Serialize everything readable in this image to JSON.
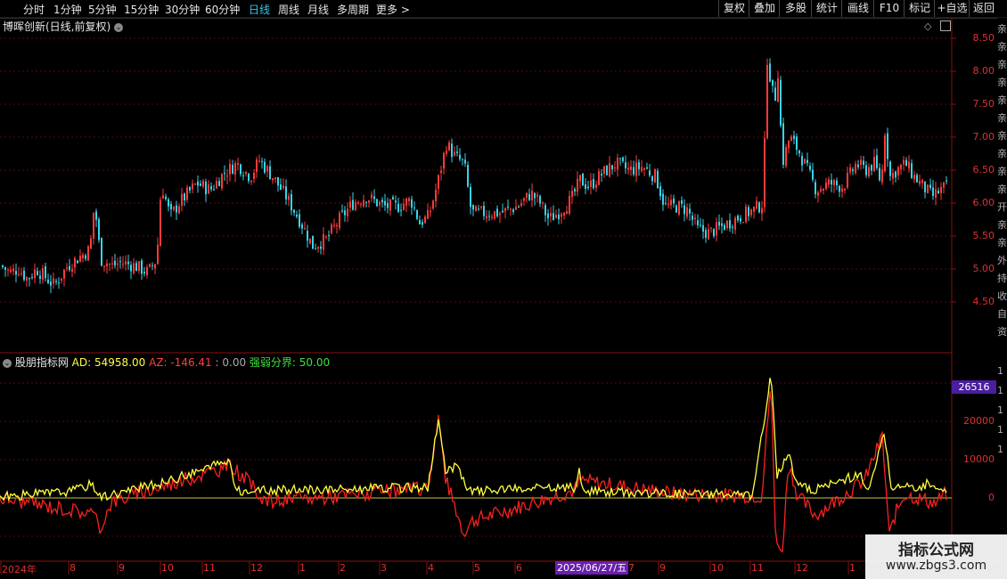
{
  "toolbar": {
    "periods": [
      "分时",
      "1分钟",
      "5分钟",
      "15分钟",
      "30分钟",
      "60分钟",
      "日线",
      "周线",
      "月线",
      "多周期",
      "更多 >"
    ],
    "active_period": "日线",
    "right_buttons": [
      "复权",
      "叠加",
      "多股",
      "统计",
      "画线",
      "F10",
      "标记",
      "+自选",
      "返回"
    ]
  },
  "main_chart": {
    "title": "博晖创新(日线,前复权)",
    "y_ticks": [
      "8.50",
      "8.00",
      "7.50",
      "7.00",
      "6.50",
      "6.00",
      "5.50",
      "5.00",
      "4.50"
    ],
    "colors": {
      "up": "#ff3b3b",
      "down": "#38d3e8"
    }
  },
  "indicator": {
    "name": "股朋指标网",
    "ad_label": "AD: 54958.00",
    "az_label": "AZ: -146.41",
    "zero_label": ": 0.00",
    "boundary_label": "强弱分界: 50.00",
    "y_ticks": [
      "20000",
      "10000",
      "0"
    ],
    "current_value": "26516",
    "colors": {
      "ad": "#ffff40",
      "az": "#ff2020",
      "zero": "#c8c840"
    }
  },
  "x_axis": {
    "labels": [
      "2024年",
      "8",
      "9",
      "10",
      "11",
      "12",
      "1",
      "2",
      "3",
      "4",
      "5",
      "6",
      "7",
      "9",
      "10",
      "11",
      "12",
      "1"
    ],
    "cursor_date": "2025/06/27/五"
  },
  "watermark": {
    "line1": "指标公式网",
    "line2": "www.zbgs3.com"
  },
  "right_strip_chars": [
    "亲",
    "亲",
    "亲",
    "亲",
    "亲",
    "亲",
    "亲",
    "亲",
    "亲",
    "亲",
    "开",
    "亲",
    "亲",
    "外",
    "持",
    "收",
    "自",
    "资",
    "1",
    "1",
    "1",
    "1",
    "1"
  ],
  "chart_data": {
    "type": "candlestick",
    "title": "博晖创新(日线,前复权)",
    "ylim": [
      4.35,
      8.75
    ],
    "indicator_ylim": [
      -16000,
      33000
    ],
    "anchors": [
      [
        0,
        5.05
      ],
      [
        10,
        4.95
      ],
      [
        20,
        5.0
      ],
      [
        30,
        4.85
      ],
      [
        40,
        5.0
      ],
      [
        60,
        4.75
      ],
      [
        75,
        5.05
      ],
      [
        90,
        5.2
      ],
      [
        100,
        5.3
      ],
      [
        105,
        6.0
      ],
      [
        112,
        5.15
      ],
      [
        125,
        5.05
      ],
      [
        135,
        5.1
      ],
      [
        150,
        5.05
      ],
      [
        165,
        4.95
      ],
      [
        175,
        5.15
      ],
      [
        180,
        6.3
      ],
      [
        190,
        5.8
      ],
      [
        200,
        6.0
      ],
      [
        220,
        6.3
      ],
      [
        235,
        6.2
      ],
      [
        250,
        6.45
      ],
      [
        265,
        6.6
      ],
      [
        280,
        6.4
      ],
      [
        290,
        6.65
      ],
      [
        305,
        6.4
      ],
      [
        320,
        6.1
      ],
      [
        335,
        5.75
      ],
      [
        350,
        5.35
      ],
      [
        365,
        5.45
      ],
      [
        380,
        5.75
      ],
      [
        395,
        6.0
      ],
      [
        410,
        6.1
      ],
      [
        430,
        5.95
      ],
      [
        445,
        5.95
      ],
      [
        460,
        6.05
      ],
      [
        470,
        5.7
      ],
      [
        480,
        5.8
      ],
      [
        490,
        6.3
      ],
      [
        500,
        6.9
      ],
      [
        510,
        6.7
      ],
      [
        520,
        6.6
      ],
      [
        528,
        5.85
      ],
      [
        540,
        5.85
      ],
      [
        560,
        5.85
      ],
      [
        580,
        5.95
      ],
      [
        595,
        6.15
      ],
      [
        605,
        6.0
      ],
      [
        615,
        5.75
      ],
      [
        625,
        5.85
      ],
      [
        640,
        6.05
      ],
      [
        650,
        6.35
      ],
      [
        660,
        6.25
      ],
      [
        675,
        6.45
      ],
      [
        690,
        6.6
      ],
      [
        705,
        6.5
      ],
      [
        720,
        6.55
      ],
      [
        735,
        6.4
      ],
      [
        745,
        5.95
      ],
      [
        760,
        5.95
      ],
      [
        770,
        5.9
      ],
      [
        782,
        5.6
      ],
      [
        795,
        5.55
      ],
      [
        810,
        5.65
      ],
      [
        830,
        5.8
      ],
      [
        845,
        5.9
      ],
      [
        855,
        6.0
      ],
      [
        860,
        8.2
      ],
      [
        868,
        7.5
      ],
      [
        872,
        8.0
      ],
      [
        877,
        6.6
      ],
      [
        885,
        7.0
      ],
      [
        895,
        6.8
      ],
      [
        905,
        6.5
      ],
      [
        915,
        6.2
      ],
      [
        930,
        6.3
      ],
      [
        945,
        6.25
      ],
      [
        960,
        6.6
      ],
      [
        970,
        6.5
      ],
      [
        980,
        6.6
      ],
      [
        988,
        6.3
      ],
      [
        992,
        7.1
      ],
      [
        998,
        6.4
      ],
      [
        1005,
        6.5
      ],
      [
        1015,
        6.6
      ],
      [
        1025,
        6.4
      ],
      [
        1035,
        6.25
      ],
      [
        1045,
        6.1
      ],
      [
        1060,
        6.25
      ]
    ],
    "ad_anchors": [
      [
        0,
        0
      ],
      [
        80,
        1500
      ],
      [
        104,
        3500
      ],
      [
        112,
        0
      ],
      [
        180,
        3500
      ],
      [
        258,
        9500
      ],
      [
        265,
        1500
      ],
      [
        480,
        2500
      ],
      [
        492,
        20000
      ],
      [
        500,
        6000
      ],
      [
        512,
        8500
      ],
      [
        525,
        1500
      ],
      [
        645,
        2500
      ],
      [
        650,
        6500
      ],
      [
        655,
        1500
      ],
      [
        845,
        500
      ],
      [
        865,
        32000
      ],
      [
        872,
        6000
      ],
      [
        885,
        10500
      ],
      [
        895,
        4000
      ],
      [
        910,
        1500
      ],
      [
        965,
        6000
      ],
      [
        975,
        1000
      ],
      [
        992,
        17000
      ],
      [
        1000,
        3000
      ],
      [
        1010,
        2000
      ],
      [
        1045,
        3500
      ],
      [
        1060,
        2000
      ]
    ],
    "az_anchors": [
      [
        0,
        0
      ],
      [
        104,
        -4000
      ],
      [
        112,
        -8000
      ],
      [
        125,
        -1000
      ],
      [
        260,
        8500
      ],
      [
        300,
        -1000
      ],
      [
        480,
        2500
      ],
      [
        492,
        21000
      ],
      [
        500,
        5000
      ],
      [
        520,
        -9000
      ],
      [
        530,
        -6000
      ],
      [
        645,
        2000
      ],
      [
        652,
        4500
      ],
      [
        760,
        1000
      ],
      [
        855,
        500
      ],
      [
        865,
        31000
      ],
      [
        870,
        -8000
      ],
      [
        877,
        -16000
      ],
      [
        885,
        9500
      ],
      [
        895,
        500
      ],
      [
        915,
        -4500
      ],
      [
        970,
        4500
      ],
      [
        990,
        16000
      ],
      [
        998,
        -10000
      ],
      [
        1005,
        -4000
      ],
      [
        1015,
        1000
      ],
      [
        1050,
        -1500
      ],
      [
        1060,
        1000
      ]
    ]
  }
}
